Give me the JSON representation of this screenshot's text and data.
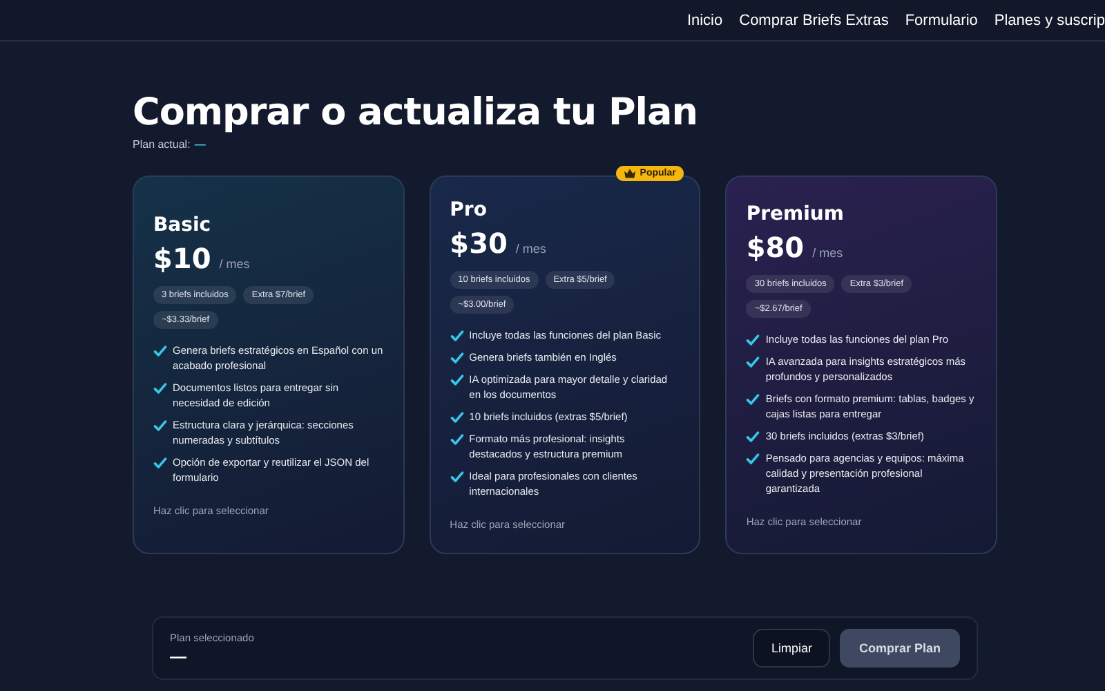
{
  "nav": {
    "links": [
      "Inicio",
      "Comprar Briefs Extras",
      "Formulario",
      "Planes y suscrip"
    ]
  },
  "heading": "Comprar o actualiza tu Plan",
  "current_plan": {
    "label": "Plan actual:",
    "value": "—"
  },
  "plans": [
    {
      "name": "Basic",
      "price": "$10",
      "period": "/ mes",
      "color": "#153248",
      "chips": [
        "3 briefs incluidos",
        "Extra $7/brief",
        "~$3.33/brief"
      ],
      "features": [
        "Genera briefs estratégicos en Español con un acabado profesional",
        "Documentos listos para entregar sin necesidad de edición",
        "Estructura clara y jerárquica: secciones numeradas y subtítulos",
        "Opción de exportar y reutilizar el JSON del formulario"
      ],
      "hint": "Haz clic para seleccionar"
    },
    {
      "name": "Pro",
      "price": "$30",
      "period": "/ mes",
      "color": "#19294a",
      "badge": "Popular",
      "chips": [
        "10 briefs incluidos",
        "Extra $5/brief",
        "~$3.00/brief"
      ],
      "features": [
        "Incluye todas las funciones del plan Basic",
        "Genera briefs también en Inglés",
        "IA optimizada para mayor detalle y claridad en los documentos",
        "10 briefs incluidos (extras $5/brief)",
        "Formato más profesional: insights destacados y estructura premium",
        "Ideal para profesionales con clientes internacionales"
      ],
      "hint": "Haz clic para seleccionar"
    },
    {
      "name": "Premium",
      "price": "$80",
      "period": "/ mes",
      "color": "#2a2150",
      "chips": [
        "30 briefs incluidos",
        "Extra $3/brief",
        "~$2.67/brief"
      ],
      "features": [
        "Incluye todas las funciones del plan Pro",
        "IA avanzada para insights estratégicos más profundos y personalizados",
        "Briefs con formato premium: tablas, badges y cajas listas para entregar",
        "30 briefs incluidos (extras $3/brief)",
        "Pensado para agencias y equipos: máxima calidad y presentación profesional garantizada"
      ],
      "hint": "Haz clic para seleccionar"
    }
  ],
  "footer": {
    "label": "Plan seleccionado",
    "value": "—",
    "buttons": [
      {
        "label": "Limpiar",
        "kind": "outline",
        "disabled": false
      },
      {
        "label": "Comprar Plan",
        "kind": "primary",
        "disabled": true
      }
    ]
  }
}
